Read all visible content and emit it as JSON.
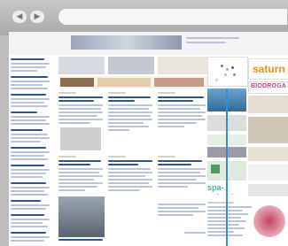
{
  "browser": {
    "back_label": "◀",
    "forward_label": "▶"
  },
  "ads": {
    "saturn": "saturn",
    "biodroga": "BIODROGA",
    "spanet": "spa-net.net"
  },
  "colors": {
    "link_blue": "#2e5494",
    "accent_blue": "#2f8fd8",
    "saturn_orange": "#f28c1a",
    "spa_teal": "#5ba8a3"
  }
}
